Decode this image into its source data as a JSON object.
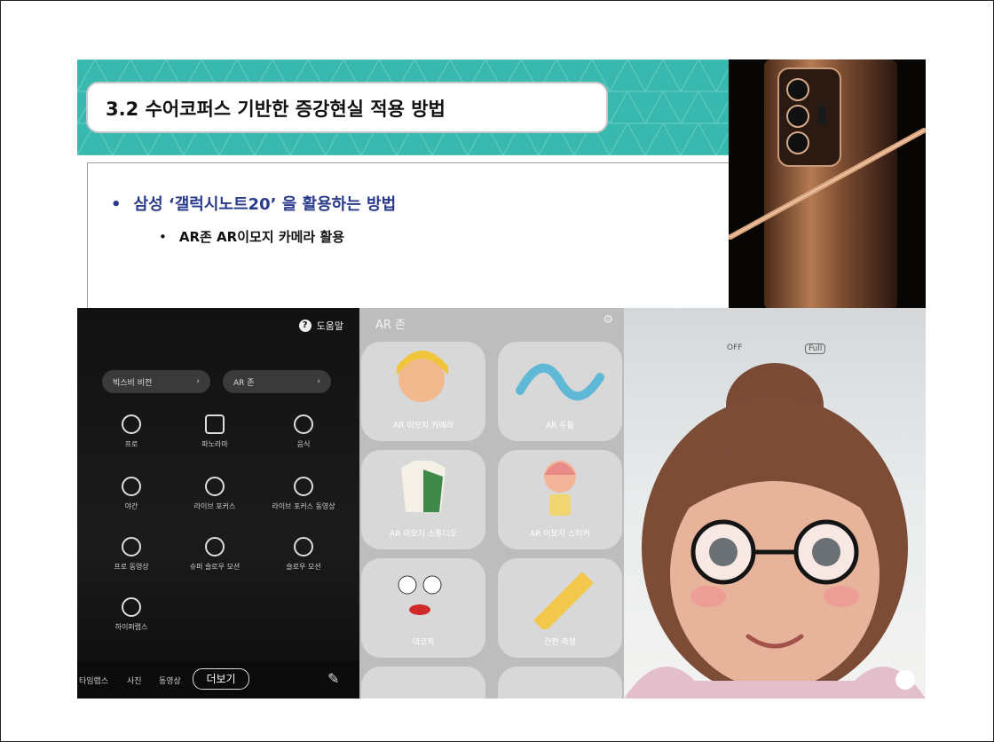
{
  "slide": {
    "title": "3.2 수어코퍼스 기반한 증강현실 적용 방법",
    "bullet_level1": "삼성 ‘갤럭시노트20’ 을 활용하는 방법",
    "bullet_level2": "AR존 AR이모지 카메라 활용",
    "bullet_char": "•"
  },
  "camera_screen": {
    "help_label": "도움말",
    "top_pills": [
      "빅스비 비전",
      "AR 존"
    ],
    "modes": [
      "프로",
      "파노라마",
      "음식",
      "야간",
      "라이브 포커스",
      "라이브 포커스 동영상",
      "프로 동영상",
      "슈퍼 슬로우 모션",
      "슬로우 모션",
      "하이퍼랩스"
    ],
    "bottom_tabs": [
      "타임랩스",
      "사진",
      "동영상"
    ],
    "more_label": "더보기"
  },
  "ar_zone_screen": {
    "title": "AR 존",
    "tiles": [
      "AR 이모지 카메라",
      "AR 두들",
      "AR 이모지 스튜디오",
      "AR 이모지 스티커",
      "데코픽",
      "간편 측정"
    ]
  },
  "avatar_screen": {
    "options": [
      "OFF",
      "Full"
    ]
  },
  "colors": {
    "banner": "#39b8b0",
    "bullet_blue": "#2a3a8a",
    "copper": "#b07a55"
  }
}
